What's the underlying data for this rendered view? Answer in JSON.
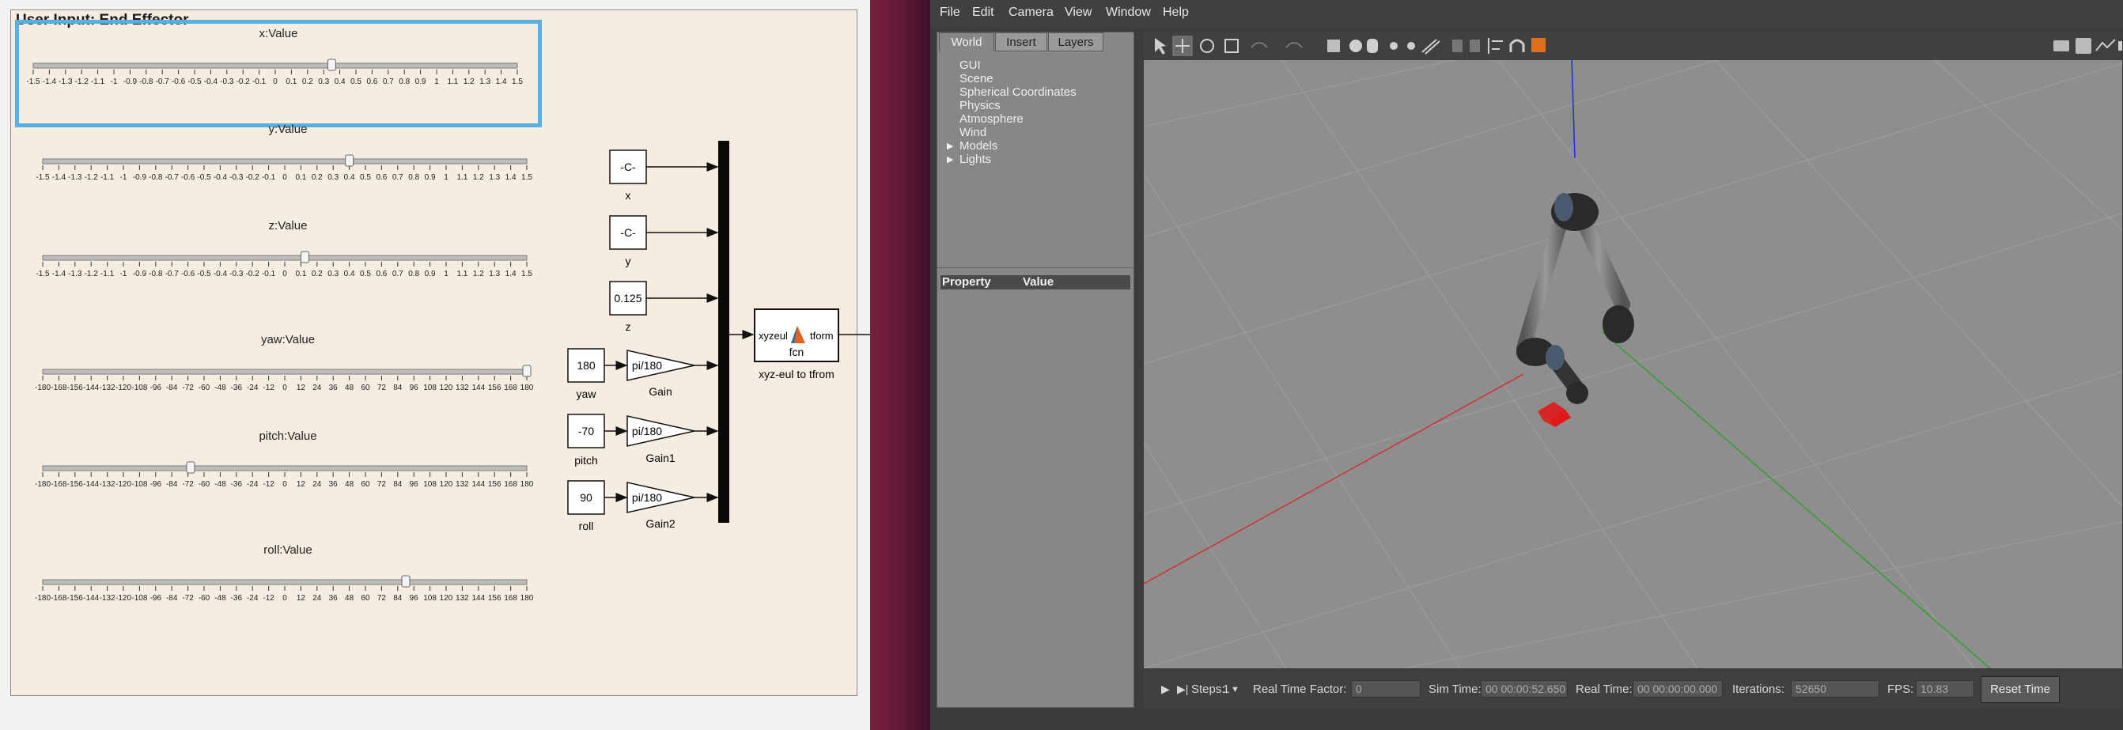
{
  "simulink": {
    "panel_title": "User Input: End Effector",
    "sliders": [
      {
        "label": "x:Value",
        "value": 0.35,
        "min": -1.5,
        "max": 1.5,
        "ticks": [
          "-1.5",
          "-1.4",
          "-1.3",
          "-1.2",
          "-1.1",
          "-1",
          "-0.9",
          "-0.8",
          "-0.7",
          "-0.6",
          "-0.5",
          "-0.4",
          "-0.3",
          "-0.2",
          "-0.1",
          "0",
          "0.1",
          "0.2",
          "0.3",
          "0.4",
          "0.5",
          "0.6",
          "0.7",
          "0.8",
          "0.9",
          "1",
          "1.1",
          "1.2",
          "1.3",
          "1.4",
          "1.5"
        ]
      },
      {
        "label": "y:Value",
        "value": 0.4,
        "min": -1.5,
        "max": 1.5,
        "ticks": [
          "-1.5",
          "-1.4",
          "-1.3",
          "-1.2",
          "-1.1",
          "-1",
          "-0.9",
          "-0.8",
          "-0.7",
          "-0.6",
          "-0.5",
          "-0.4",
          "-0.3",
          "-0.2",
          "-0.1",
          "0",
          "0.1",
          "0.2",
          "0.3",
          "0.4",
          "0.5",
          "0.6",
          "0.7",
          "0.8",
          "0.9",
          "1",
          "1.1",
          "1.2",
          "1.3",
          "1.4",
          "1.5"
        ]
      },
      {
        "label": "z:Value",
        "value": 0.125,
        "min": -1.5,
        "max": 1.5,
        "ticks": [
          "-1.5",
          "-1.4",
          "-1.3",
          "-1.2",
          "-1.1",
          "-1",
          "-0.9",
          "-0.8",
          "-0.7",
          "-0.6",
          "-0.5",
          "-0.4",
          "-0.3",
          "-0.2",
          "-0.1",
          "0",
          "0.1",
          "0.2",
          "0.3",
          "0.4",
          "0.5",
          "0.6",
          "0.7",
          "0.8",
          "0.9",
          "1",
          "1.1",
          "1.2",
          "1.3",
          "1.4",
          "1.5"
        ]
      },
      {
        "label": "yaw:Value",
        "value": 180,
        "min": -180,
        "max": 180,
        "ticks": [
          "-180",
          "-168",
          "-156",
          "-144",
          "-132",
          "-120",
          "-108",
          "-96",
          "-84",
          "-72",
          "-60",
          "-48",
          "-36",
          "-24",
          "-12",
          "0",
          "12",
          "24",
          "36",
          "48",
          "60",
          "72",
          "84",
          "96",
          "108",
          "120",
          "132",
          "144",
          "156",
          "168",
          "180"
        ]
      },
      {
        "label": "pitch:Value",
        "value": -70,
        "min": -180,
        "max": 180,
        "ticks": [
          "-180",
          "-168",
          "-156",
          "-144",
          "-132",
          "-120",
          "-108",
          "-96",
          "-84",
          "-72",
          "-60",
          "-48",
          "-36",
          "-24",
          "-12",
          "0",
          "12",
          "24",
          "36",
          "48",
          "60",
          "72",
          "84",
          "96",
          "108",
          "120",
          "132",
          "144",
          "156",
          "168",
          "180"
        ]
      },
      {
        "label": "roll:Value",
        "value": 90,
        "min": -180,
        "max": 180,
        "ticks": [
          "-180",
          "-168",
          "-156",
          "-144",
          "-132",
          "-120",
          "-108",
          "-96",
          "-84",
          "-72",
          "-60",
          "-48",
          "-36",
          "-24",
          "-12",
          "0",
          "12",
          "24",
          "36",
          "48",
          "60",
          "72",
          "84",
          "96",
          "108",
          "120",
          "132",
          "144",
          "156",
          "168",
          "180"
        ]
      }
    ],
    "blocks": {
      "x": {
        "value": "-C-",
        "name": "x"
      },
      "y": {
        "value": "-C-",
        "name": "y"
      },
      "z": {
        "value": "0.125",
        "name": "z"
      },
      "yaw": {
        "value": "180",
        "name": "yaw"
      },
      "pitch": {
        "value": "-70",
        "name": "pitch"
      },
      "roll": {
        "value": "90",
        "name": "roll"
      },
      "gain": {
        "value": "pi/180",
        "name": "Gain"
      },
      "gain1": {
        "value": "pi/180",
        "name": "Gain1"
      },
      "gain2": {
        "value": "pi/180",
        "name": "Gain2"
      },
      "fcn": {
        "in": "xyzeul",
        "out": "tform",
        "label": "fcn",
        "name": "xyz-eul to tfrom"
      }
    }
  },
  "gazebo": {
    "menu": [
      "File",
      "Edit",
      "Camera",
      "View",
      "Window",
      "Help"
    ],
    "tabs": [
      "World",
      "Insert",
      "Layers"
    ],
    "tree": [
      "GUI",
      "Scene",
      "Spherical Coordinates",
      "Physics",
      "Atmosphere",
      "Wind",
      "Models",
      "Lights"
    ],
    "prop_header": {
      "property": "Property",
      "value": "Value"
    },
    "bottom": {
      "steps_label": "Steps:",
      "steps_value": "1",
      "rtf_label": "Real Time Factor:",
      "rtf_value": "0",
      "sim_label": "Sim Time:",
      "sim_value": "00 00:00:52.650",
      "real_label": "Real Time:",
      "real_value": "00 00:00:00.000",
      "iter_label": "Iterations:",
      "iter_value": "52650",
      "fps_label": "FPS:",
      "fps_value": "10.83",
      "reset": "Reset Time"
    },
    "colors": {
      "x_axis": "#d03030",
      "y_axis": "#30a030",
      "z_axis": "#2030d0",
      "target": "#e01818"
    }
  }
}
